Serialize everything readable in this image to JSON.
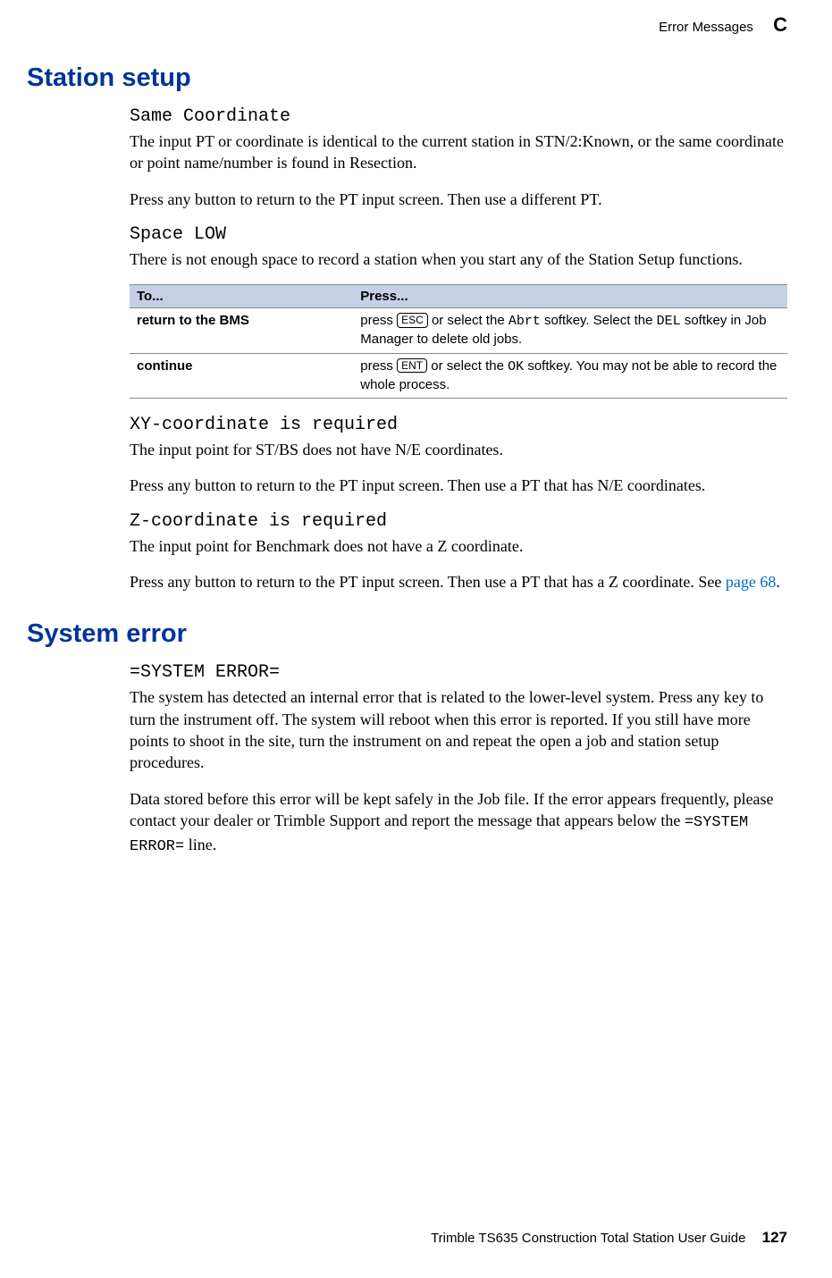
{
  "header": {
    "title": "Error Messages",
    "section_letter": "C"
  },
  "station_setup": {
    "heading": "Station setup",
    "same_coordinate": {
      "title": "Same Coordinate",
      "p1": "The input PT or coordinate is identical to the current station in STN/2:Known, or the same coordinate or point name/number is found in Resection.",
      "p2": "Press any button to return to the PT input screen. Then use a different PT."
    },
    "space_low": {
      "title": "Space LOW",
      "p1": "There is not enough space to record a station when you start any of the Station Setup functions.",
      "table": {
        "headers": [
          "To...",
          "Press..."
        ],
        "rows": [
          {
            "to": "return to the BMS",
            "press_parts": {
              "t1": "press ",
              "key1": "ESC",
              "t2": " or select the ",
              "sk1": "Abrt",
              "t3": " softkey. Select the ",
              "sk2": "DEL",
              "t4": " softkey in Job Manager to delete old jobs."
            }
          },
          {
            "to": "continue",
            "press_parts": {
              "t1": "press ",
              "key1": "ENT",
              "t2": " or select the ",
              "sk1": "OK",
              "t3": " softkey. You may not be able to record the whole process."
            }
          }
        ]
      }
    },
    "xy_required": {
      "title": "XY-coordinate is required",
      "p1": "The input point for ST/BS does not have N/E coordinates.",
      "p2": "Press any button to return to the PT input screen. Then use a PT that has N/E coordinates."
    },
    "z_required": {
      "title": "Z-coordinate is required",
      "p1": "The input point for Benchmark does not have a Z coordinate.",
      "p2_1": "Press any button to return to the PT input screen. Then use a PT that has a Z coordinate. See ",
      "p2_link": "page 68",
      "p2_2": "."
    }
  },
  "system_error": {
    "heading": "System error",
    "title": "=SYSTEM ERROR=",
    "p1": "The system has detected an internal error that is related to the lower-level system. Press any key to turn the instrument off. The system will reboot when this error is reported. If you still have more points to shoot in the site, turn the instrument on and repeat the open a job and station setup procedures.",
    "p2_1": "Data stored before this error will be kept safely in the Job file. If the error appears frequently, please contact your dealer or Trimble Support and report the message that appears below the ",
    "p2_mono": "=SYSTEM ERROR=",
    "p2_2": " line."
  },
  "footer": {
    "guide": "Trimble TS635 Construction Total Station User Guide",
    "page": "127"
  }
}
